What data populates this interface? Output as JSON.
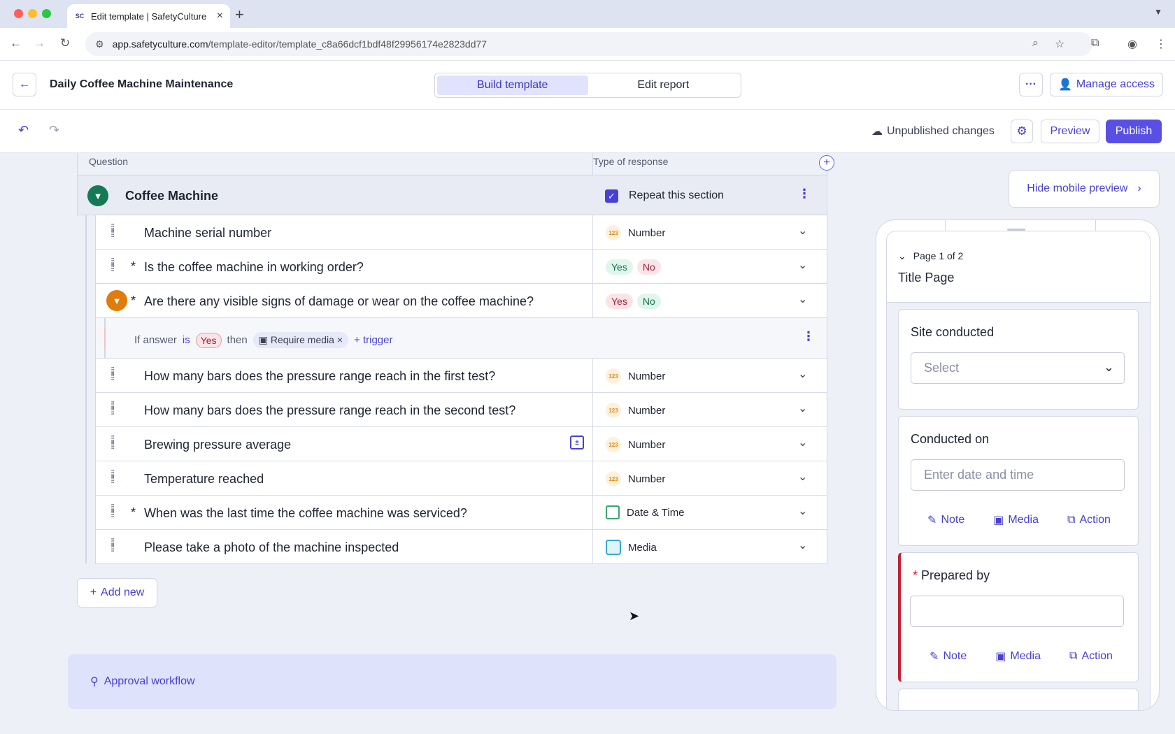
{
  "browser": {
    "tab_title": "Edit template | SafetyCulture",
    "tab_favicon": "SC",
    "url_host": "app.safetyculture.com",
    "url_path": "/template-editor/template_c8a66dcf1bdf48f29956174e2823dd77"
  },
  "header": {
    "title": "Daily Coffee Machine Maintenance",
    "tabs": [
      {
        "label": "Build template",
        "active": true
      },
      {
        "label": "Edit report",
        "active": false
      }
    ],
    "manage_access": "Manage access"
  },
  "toolbar": {
    "status": "Unpublished changes",
    "preview": "Preview",
    "publish": "Publish"
  },
  "table": {
    "col_question": "Question",
    "col_response": "Type of response",
    "section": {
      "name": "Coffee Machine",
      "repeat_label": "Repeat this section",
      "repeat_checked": true
    },
    "rows": [
      {
        "text": "Machine serial number",
        "required": false,
        "response": "Number"
      },
      {
        "text": "Is the coffee machine in working order?",
        "required": true,
        "response": "Yes/No"
      },
      {
        "text": "Are there any visible signs of damage or wear on the coffee machine?",
        "required": true,
        "response": "Yes/No"
      },
      {
        "text": "How many bars does the pressure range reach in the first test?",
        "required": false,
        "response": "Number"
      },
      {
        "text": "How many bars does the pressure range reach in the second test?",
        "required": false,
        "response": "Number"
      },
      {
        "text": "Brewing pressure average",
        "required": false,
        "response": "Number"
      },
      {
        "text": "Temperature reached",
        "required": false,
        "response": "Number"
      },
      {
        "text": "When was the last time the coffee machine was serviced?",
        "required": true,
        "response": "Date & Time"
      },
      {
        "text": "Please take a photo of the machine inspected",
        "required": false,
        "response": "Media"
      }
    ],
    "yes": "Yes",
    "no": "No",
    "logic": {
      "if_answer": "If answer",
      "is": "is",
      "value": "Yes",
      "then": "then",
      "action": "Require media",
      "trigger": "+ trigger"
    }
  },
  "add_new": "Add new",
  "approval": "Approval workflow",
  "preview": {
    "hide": "Hide mobile preview",
    "page": "Page 1 of 2",
    "page_title": "Title Page",
    "site_label": "Site conducted",
    "site_placeholder": "Select",
    "conducted_label": "Conducted on",
    "conducted_placeholder": "Enter date and time",
    "prepared_label": "Prepared by",
    "note": "Note",
    "media": "Media",
    "action": "Action"
  },
  "colors": {
    "accent": "#4740d4",
    "publish": "#5a4fe4",
    "section_green": "#147a55",
    "logic_orange": "#e07b0c"
  }
}
